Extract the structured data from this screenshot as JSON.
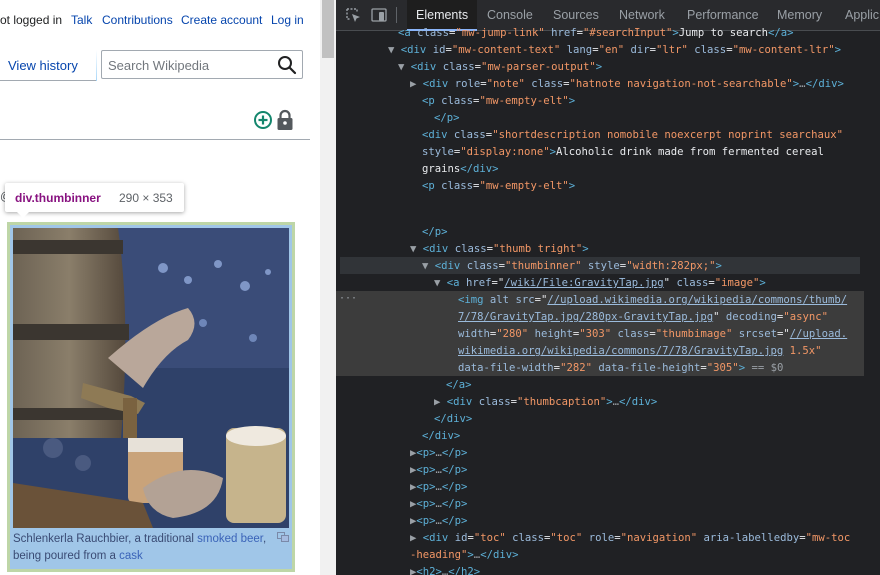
{
  "wiki": {
    "personal_links": {
      "not_logged_in": "ot logged in",
      "talk": "Talk",
      "contributions": "Contributions",
      "create_account": "Create account",
      "log_in": "Log in"
    },
    "view_history": "View history",
    "search": {
      "placeholder": "Search Wikipedia",
      "value": ""
    },
    "edge_char": "@",
    "tooltip": {
      "selector": "div.thumbinner",
      "dimensions": "290 × 353"
    },
    "caption": {
      "text1": "Schlenkerla Rauchbier, a traditional ",
      "link1": "smoked beer",
      "text2": ", being poured from a ",
      "link2": "cask"
    },
    "icons": [
      "search-icon",
      "add-circle-icon",
      "lock-icon",
      "magnify-icon"
    ]
  },
  "devtools": {
    "tabs": [
      "Elements",
      "Console",
      "Sources",
      "Network",
      "Performance",
      "Memory",
      "Applic"
    ],
    "active_tab": "Elements",
    "tools": [
      "inspect-element-icon",
      "device-toolbar-icon"
    ],
    "highlight_color": "#6fa8dc",
    "dom": {
      "r0": {
        "tag_open": "<a",
        "attr1": "class",
        "val1": "\"mw-jump-link\"",
        "attr2": "href",
        "val2": "\"#searchInput\"",
        "text": "Jump to search",
        "tag_close": "</a>"
      },
      "r1": {
        "tag_open": "<div",
        "attr1": "id",
        "val1": "\"mw-content-text\"",
        "attr2": "lang",
        "val2": "\"en\"",
        "attr3": "dir",
        "val3": "\"ltr\"",
        "attr4": "class",
        "val4": "\"mw-content-ltr\""
      },
      "r2": {
        "tag_open": "<div",
        "attr1": "class",
        "val1": "\"mw-parser-output\""
      },
      "r3": {
        "tag_open": "<div",
        "attr1": "role",
        "val1": "\"note\"",
        "attr2": "class",
        "val2": "\"hatnote navigation-not-searchable\"",
        "ellipsis": "…",
        "tag_close": "</div>"
      },
      "r4": {
        "tag_open": "<p",
        "attr1": "class",
        "val1": "\"mw-empty-elt\""
      },
      "r5": {
        "tag_close": "</p>"
      },
      "r6": {
        "tag_open": "<div",
        "attr1": "class",
        "val1": "\"shortdescription nomobile noexcerpt noprint searchaux\""
      },
      "r7": {
        "attr1": "style",
        "val1": "\"display:none\"",
        "text": "Alcoholic drink made from fermented cereal"
      },
      "r8": {
        "text": "grains",
        "tag_close": "</div>"
      },
      "r9": {
        "tag_open": "<p",
        "attr1": "class",
        "val1": "\"mw-empty-elt\""
      },
      "r10": {
        "tag_close": "</p>"
      },
      "r11": {
        "tag_open": "<div",
        "attr1": "class",
        "val1": "\"thumb tright\""
      },
      "r12": {
        "tag_open": "<div",
        "attr1": "class",
        "val1": "\"thumbinner\"",
        "attr2": "style",
        "val2": "\"width:282px;\""
      },
      "r13": {
        "tag_open": "<a",
        "attr1": "href",
        "val1": "/wiki/File:GravityTap.jpg",
        "attr2": "class",
        "val2": "\"image\""
      },
      "r14": {
        "tag_open": "<img",
        "attr1": "alt",
        "attr2": "src",
        "val2": "//upload.wikimedia.org/wikipedia/commons/thumb/"
      },
      "r15": {
        "val1": "7/78/GravityTap.jpg/280px-GravityTap.jpg",
        "attr2": "decoding",
        "val2": "\"async\""
      },
      "r16": {
        "attr1": "width",
        "val1": "\"280\"",
        "attr2": "height",
        "val2": "\"303\"",
        "attr3": "class",
        "val3": "\"thumbimage\"",
        "attr4": "srcset",
        "val4": "//upload."
      },
      "r17": {
        "val1": "wikimedia.org/wikipedia/commons/7/78/GravityTap.jpg",
        "val2": " 1.5x\""
      },
      "r18": {
        "attr1": "data-file-width",
        "val1": "\"282\"",
        "attr2": "data-file-height",
        "val2": "\"305\"",
        "marker": " == $0"
      },
      "r19": {
        "tag_close": "</a>"
      },
      "r20": {
        "tag_open": "<div",
        "attr1": "class",
        "val1": "\"thumbcaption\"",
        "ellipsis": "…",
        "tag_close": "</div>"
      },
      "r21": {
        "tag_close": "</div>"
      },
      "r22": {
        "tag_close": "</div>"
      },
      "r23": {
        "tag_open": "<p>",
        "ellipsis": "…",
        "tag_close": "</p>"
      },
      "r24": {
        "tag_open": "<p>",
        "ellipsis": "…",
        "tag_close": "</p>"
      },
      "r25": {
        "tag_open": "<p>",
        "ellipsis": "…",
        "tag_close": "</p>"
      },
      "r26": {
        "tag_open": "<p>",
        "ellipsis": "…",
        "tag_close": "</p>"
      },
      "r27": {
        "tag_open": "<p>",
        "ellipsis": "…",
        "tag_close": "</p>"
      },
      "r28": {
        "tag_open": "<div",
        "attr1": "id",
        "val1": "\"toc\"",
        "attr2": "class",
        "val2": "\"toc\"",
        "attr3": "role",
        "val3": "\"navigation\"",
        "attr4": "aria-labelledby",
        "val4": "\"mw-toc"
      },
      "r29": {
        "val1": "-heading\"",
        "ellipsis": "…",
        "tag_close": "</div>"
      },
      "r30": {
        "tag_open": "<h2>",
        "ellipsis": "…",
        "tag_close": "</h2>"
      }
    }
  }
}
